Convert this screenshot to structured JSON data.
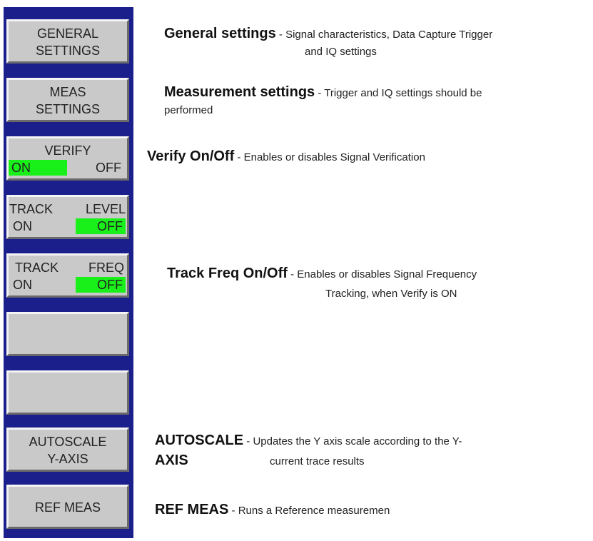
{
  "softkeys": {
    "general": {
      "line1": "GENERAL",
      "line2": "SETTINGS"
    },
    "meas": {
      "line1": "MEAS",
      "line2": "SETTINGS"
    },
    "verify": {
      "title": "VERIFY",
      "on": "ON",
      "off": "OFF",
      "active": "on"
    },
    "track_level": {
      "title_left": "TRACK",
      "title_right": "LEVEL",
      "on": "ON",
      "off": "OFF",
      "active": "off"
    },
    "track_freq": {
      "title_left": "TRACK",
      "title_right": "FREQ",
      "on": "ON",
      "off": "OFF",
      "active": "off"
    },
    "autoscale": {
      "line1": "AUTOSCALE",
      "line2": "Y-AXIS"
    },
    "ref_meas": {
      "label": "REF MEAS"
    }
  },
  "descriptions": {
    "general": {
      "title": "General settings",
      "sep": " - ",
      "text1": "Signal characteristics, Data Capture Trigger",
      "text2": "and IQ settings"
    },
    "meas": {
      "title": "Measurement settings",
      "sep": " - ",
      "text1": "Trigger and IQ settings should be",
      "text2": "performed"
    },
    "verify": {
      "title": "Verify On/Off",
      "sep": " - ",
      "text1": "Enables or disables Signal Verification"
    },
    "track_freq": {
      "title": "Track Freq On/Off",
      "sep": " - ",
      "text1": "Enables or disables Signal Frequency",
      "text2": "Tracking, when Verify is ON"
    },
    "autoscale": {
      "title1": "AUTOSCALE",
      "sep": " - ",
      "text1": "Updates the Y axis scale according to the Y-",
      "title2": "AXIS",
      "text2": "current trace results"
    },
    "ref_meas": {
      "title": "REF MEAS",
      "sep": " - ",
      "text1": "Runs a Reference measuremen"
    }
  },
  "colors": {
    "panel": "#1a1f8c",
    "softkey": "#c9c9c9",
    "active": "#19f019"
  }
}
